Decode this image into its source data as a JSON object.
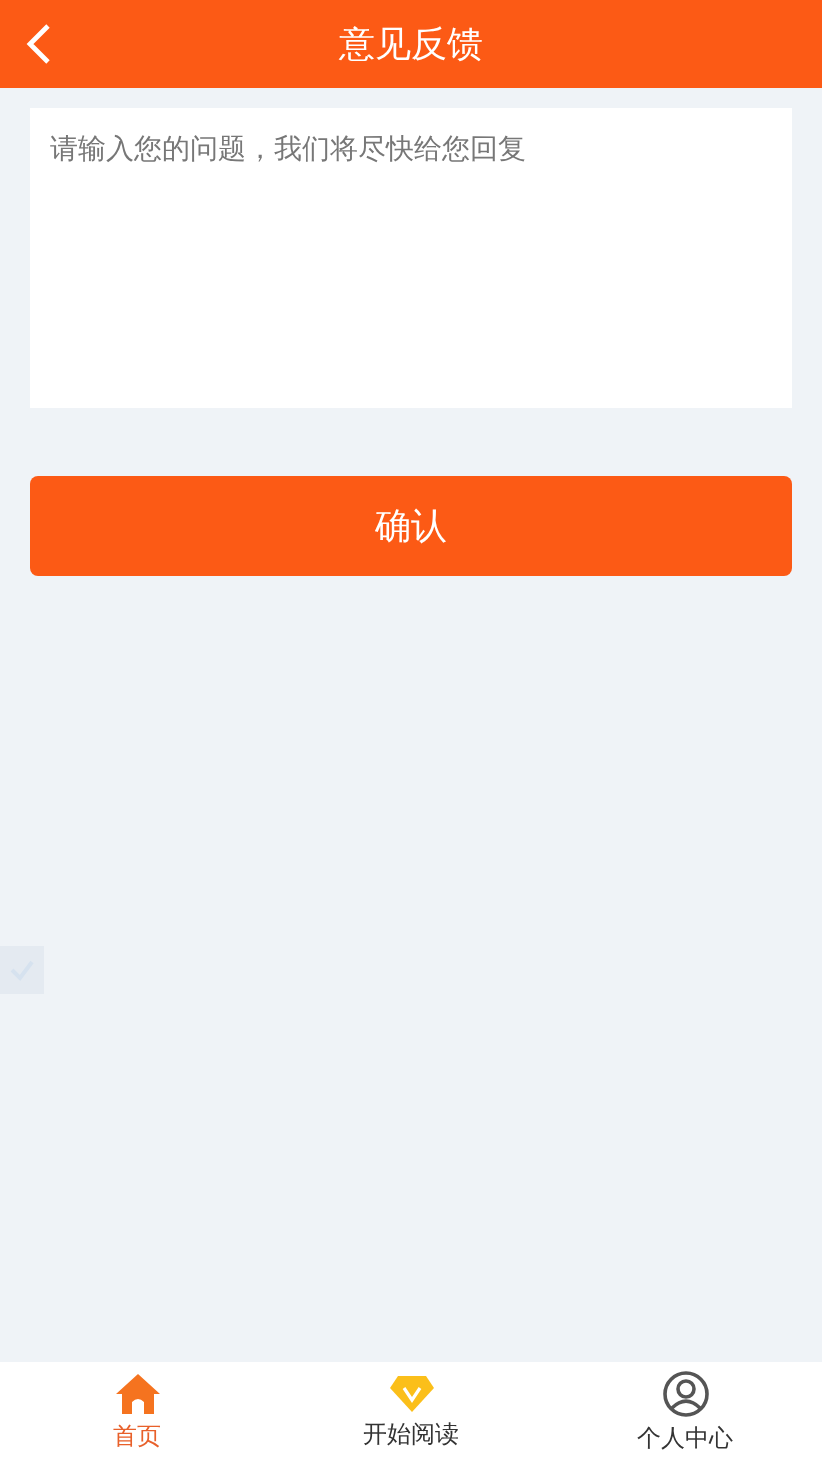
{
  "header": {
    "title": "意见反馈"
  },
  "feedback": {
    "placeholder": "请输入您的问题，我们将尽快给您回复"
  },
  "submit_button": "确认",
  "tab_bar": [
    {
      "kind": "home",
      "label": "首页",
      "selected": true
    },
    {
      "kind": "diamond",
      "label": "开始阅读",
      "selected": false
    },
    {
      "kind": "user",
      "label": "个人中心",
      "selected": false
    }
  ]
}
